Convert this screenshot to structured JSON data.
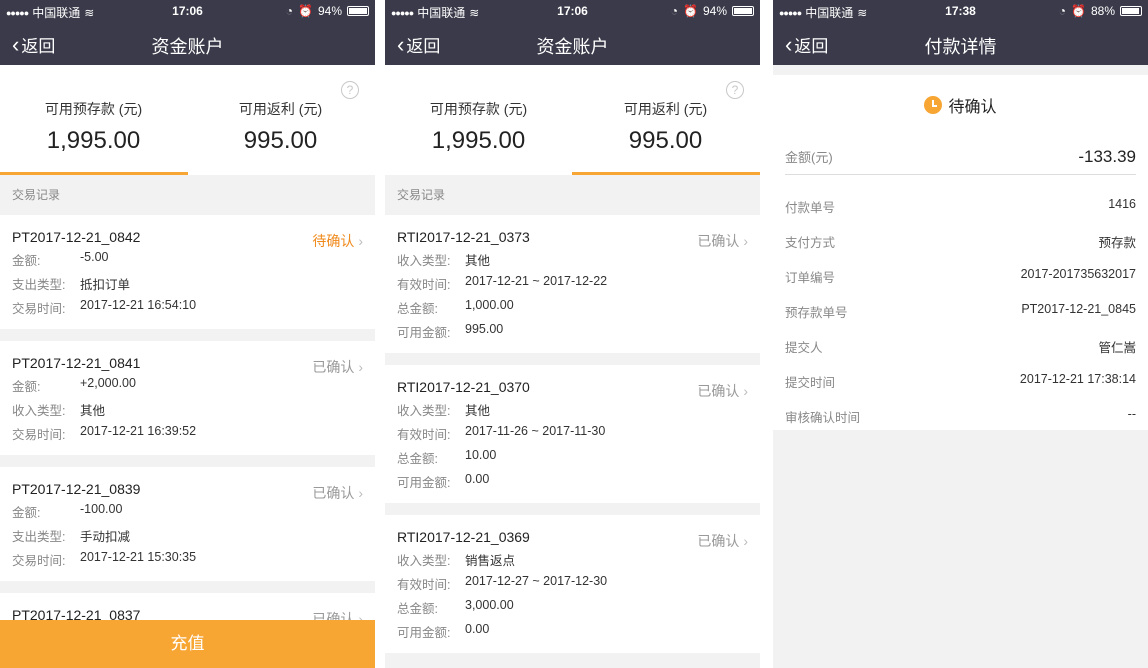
{
  "status_bars": [
    {
      "carrier": "中国联通",
      "time": "17:06",
      "battery": "94%",
      "battery_level": 0.94
    },
    {
      "carrier": "中国联通",
      "time": "17:06",
      "battery": "94%",
      "battery_level": 0.94
    },
    {
      "carrier": "中国联通",
      "time": "17:38",
      "battery": "88%",
      "battery_level": 0.88
    }
  ],
  "screen1": {
    "back": "返回",
    "title": "资金账户",
    "summary": {
      "deposit_label": "可用预存款 (元)",
      "deposit_amount": "1,995.00",
      "rebate_label": "可用返利 (元)",
      "rebate_amount": "995.00",
      "help": "?",
      "active_tab": "deposit"
    },
    "section": "交易记录",
    "records": [
      {
        "id": "PT2017-12-21_0842",
        "status": "待确认",
        "pending": true,
        "rows": [
          {
            "k": "金额:",
            "v": "-5.00"
          },
          {
            "k": "支出类型:",
            "v": "抵扣订单"
          },
          {
            "k": "交易时间:",
            "v": "2017-12-21 16:54:10"
          }
        ]
      },
      {
        "id": "PT2017-12-21_0841",
        "status": "已确认",
        "pending": false,
        "rows": [
          {
            "k": "金额:",
            "v": "+2,000.00"
          },
          {
            "k": "收入类型:",
            "v": "其他"
          },
          {
            "k": "交易时间:",
            "v": "2017-12-21 16:39:52"
          }
        ]
      },
      {
        "id": "PT2017-12-21_0839",
        "status": "已确认",
        "pending": false,
        "rows": [
          {
            "k": "金额:",
            "v": "-100.00"
          },
          {
            "k": "支出类型:",
            "v": "手动扣减"
          },
          {
            "k": "交易时间:",
            "v": "2017-12-21 15:30:35"
          }
        ]
      },
      {
        "id": "PT2017-12-21_0837",
        "status": "已确认",
        "pending": false,
        "rows": []
      }
    ],
    "recharge": "充值"
  },
  "screen2": {
    "back": "返回",
    "title": "资金账户",
    "summary": {
      "deposit_label": "可用预存款 (元)",
      "deposit_amount": "1,995.00",
      "rebate_label": "可用返利 (元)",
      "rebate_amount": "995.00",
      "help": "?",
      "active_tab": "rebate"
    },
    "section": "交易记录",
    "records": [
      {
        "id": "RTI2017-12-21_0373",
        "status": "已确认",
        "pending": false,
        "rows": [
          {
            "k": "收入类型:",
            "v": "其他"
          },
          {
            "k": "有效时间:",
            "v": "2017-12-21 ~ 2017-12-22"
          },
          {
            "k": "总金额:",
            "v": "1,000.00"
          },
          {
            "k": "可用金额:",
            "v": "995.00"
          }
        ]
      },
      {
        "id": "RTI2017-12-21_0370",
        "status": "已确认",
        "pending": false,
        "rows": [
          {
            "k": "收入类型:",
            "v": "其他"
          },
          {
            "k": "有效时间:",
            "v": "2017-11-26 ~ 2017-11-30"
          },
          {
            "k": "总金额:",
            "v": "10.00"
          },
          {
            "k": "可用金额:",
            "v": "0.00"
          }
        ]
      },
      {
        "id": "RTI2017-12-21_0369",
        "status": "已确认",
        "pending": false,
        "rows": [
          {
            "k": "收入类型:",
            "v": "销售返点"
          },
          {
            "k": "有效时间:",
            "v": "2017-12-27 ~ 2017-12-30"
          },
          {
            "k": "总金额:",
            "v": "3,000.00"
          },
          {
            "k": "可用金额:",
            "v": "0.00"
          }
        ]
      }
    ]
  },
  "screen3": {
    "back": "返回",
    "title": "付款详情",
    "status": "待确认",
    "amount_label": "金额(元)",
    "amount": "-133.39",
    "details": [
      {
        "k": "付款单号",
        "v": "1416"
      },
      {
        "k": "支付方式",
        "v": "预存款"
      },
      {
        "k": "订单编号",
        "v": "2017-201735632017"
      },
      {
        "k": "预存款单号",
        "v": "PT2017-12-21_0845"
      },
      {
        "k": "提交人",
        "v": "管仁嵩"
      },
      {
        "k": "提交时间",
        "v": "2017-12-21 17:38:14"
      },
      {
        "k": "审核确认时间",
        "v": "--"
      }
    ]
  },
  "colors": {
    "nav": "#3a3a4a",
    "accent": "#f7a533",
    "pending": "#f08a1c"
  }
}
